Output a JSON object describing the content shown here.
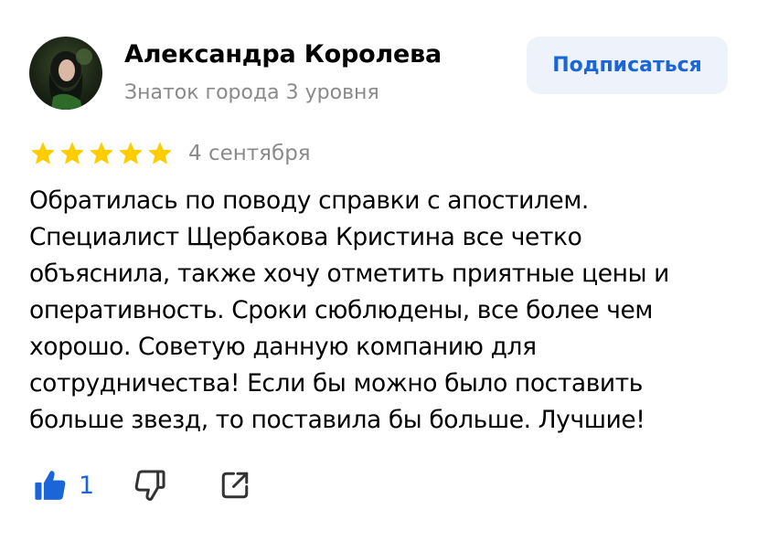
{
  "author": {
    "name": "Александра Королева",
    "level": "Знаток города 3 уровня"
  },
  "subscribe_label": "Подписаться",
  "review": {
    "rating": 5,
    "rating_max": 5,
    "date": "4 сентября",
    "text": "Обратилась по поводу справки с апостилем.\nСпециалист Щербакова Кристина все четко\nобъяснила, также хочу отметить приятные цены и\nоперативность. Сроки сюблюдены, все более чем\nхорошо. Советую данную компанию для\nсотрудничества! Если бы можно было поставить\nбольше звезд, то поставила бы больше. Лучшие!"
  },
  "actions": {
    "like_count": "1",
    "like_icon": "thumbs-up-icon",
    "dislike_icon": "thumbs-down-icon",
    "share_icon": "share-icon"
  },
  "colors": {
    "star": "#FFCC00",
    "accent": "#1A66D9",
    "muted_text": "#8A8A8A",
    "button_bg": "#EEF3FB"
  }
}
